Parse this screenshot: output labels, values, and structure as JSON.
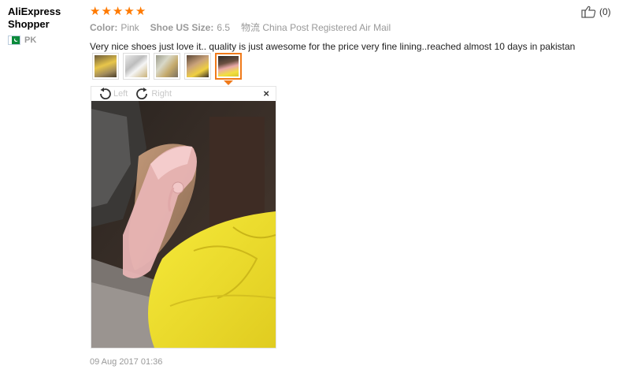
{
  "user": {
    "name": "AliExpress Shopper",
    "country_code": "PK"
  },
  "rating": {
    "stars": 5
  },
  "meta": {
    "color_label": "Color:",
    "color_value": "Pink",
    "size_label": "Shoe US Size:",
    "size_value": "6.5",
    "shipping_value": "物流 China Post Registered Air Mail"
  },
  "review_text": "Very nice shoes just love it.. quality is just awesome for the price very fine lining..reached almost 10 days in pakistan",
  "photos": {
    "count": 5,
    "active_index": 4
  },
  "viewer": {
    "rotate_left": "Left",
    "rotate_right": "Right",
    "close": "×"
  },
  "date": "09 Aug 2017 01:36",
  "helpful": {
    "count_text": "(0)"
  },
  "colors": {
    "star": "#ff7a00",
    "active_border": "#f07a1a",
    "flag_green": "#0b8a3b"
  }
}
